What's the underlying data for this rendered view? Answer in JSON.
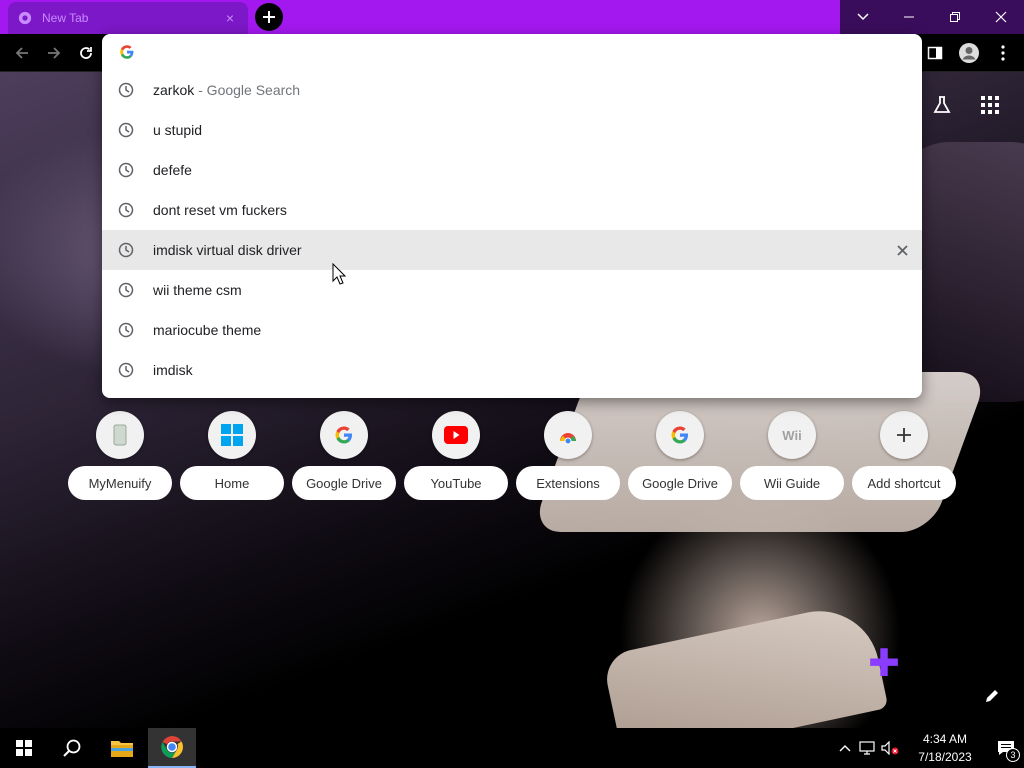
{
  "browser": {
    "tab_title": "New Tab",
    "tab_close": "×",
    "new_tab": "+"
  },
  "omnibox": {
    "value": "",
    "placeholder": "",
    "suggestions": [
      {
        "text": "zarkok",
        "desc": " - Google Search",
        "hover": false
      },
      {
        "text": "u stupid",
        "desc": "",
        "hover": false
      },
      {
        "text": "defefe",
        "desc": "",
        "hover": false
      },
      {
        "text": "dont reset vm fuckers",
        "desc": "",
        "hover": false
      },
      {
        "text": "imdisk virtual disk driver",
        "desc": "",
        "hover": true
      },
      {
        "text": "wii theme csm",
        "desc": "",
        "hover": false
      },
      {
        "text": "mariocube theme",
        "desc": "",
        "hover": false
      },
      {
        "text": "imdisk",
        "desc": "",
        "hover": false
      }
    ]
  },
  "shortcuts": [
    {
      "label": "MyMenuify",
      "icon": "mymenuify-icon"
    },
    {
      "label": "Home",
      "icon": "windows-icon"
    },
    {
      "label": "Google Drive",
      "icon": "google-icon"
    },
    {
      "label": "YouTube",
      "icon": "youtube-icon"
    },
    {
      "label": "Extensions",
      "icon": "chrome-webstore-icon"
    },
    {
      "label": "Google Drive",
      "icon": "google-icon"
    },
    {
      "label": "Wii Guide",
      "icon": "wii-icon",
      "icon_text": "Wii"
    },
    {
      "label": "Add shortcut",
      "icon": "plus-icon"
    }
  ],
  "taskbar": {
    "time": "4:34 AM",
    "date": "7/18/2023",
    "notification_count": "3"
  },
  "colors": {
    "tabstrip": "#a418f0",
    "active_tab": "#7d18c8",
    "hover_row": "#e8e8e8"
  }
}
